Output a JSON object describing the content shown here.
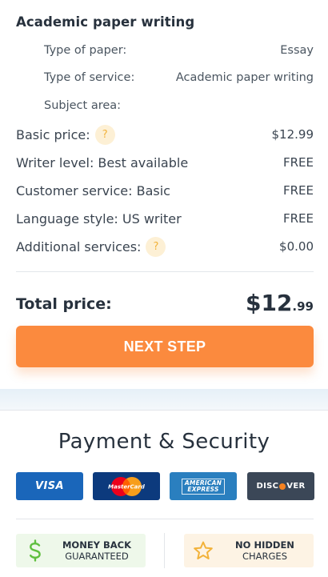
{
  "order": {
    "paper_title": "Academic paper writing",
    "details": [
      {
        "label": "Type of paper:",
        "value": "Essay"
      },
      {
        "label": "Type of service:",
        "value": "Academic paper writing"
      },
      {
        "label": "Subject area:",
        "value": ""
      }
    ],
    "help_symbol": "?",
    "prices": [
      {
        "label": "Basic price:",
        "value": "$12.99"
      },
      {
        "label": "Writer level: Best available",
        "value": "FREE"
      },
      {
        "label": "Customer service: Basic",
        "value": "FREE"
      },
      {
        "label": "Language style: US writer",
        "value": "FREE"
      },
      {
        "label": "Additional services:",
        "value": "$0.00"
      }
    ],
    "total_label": "Total price:",
    "total_dollars": "$12",
    "total_cents": ".99",
    "next_label": "NEXT STEP"
  },
  "security": {
    "title": "Payment & Security",
    "cards": {
      "visa": "VISA",
      "mastercard": "MasterCard",
      "amex_line1": "AMERICAN",
      "amex_line2": "EXPRESS",
      "discover_pre": "DISC",
      "discover_post": "VER"
    },
    "badges": {
      "money_line1": "MONEY BACK",
      "money_line2": "GUARANTEED",
      "hidden_line1": "NO HIDDEN",
      "hidden_line2": "CHARGES"
    }
  },
  "colors": {
    "accent": "#fb8a3e",
    "help_bg": "#fdf0d5",
    "help_fg": "#f2b23a",
    "money_icon": "#5fbf3f",
    "star_icon": "#f2b23a"
  },
  "icons": [
    "help-icon",
    "dollar-icon",
    "star-icon",
    "visa-logo",
    "mastercard-logo",
    "amex-logo",
    "discover-logo"
  ]
}
